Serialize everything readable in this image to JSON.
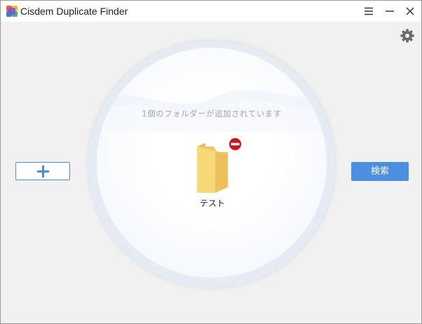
{
  "window": {
    "title": "Cisdem Duplicate Finder"
  },
  "titlebar_icons": {
    "menu": "hamburger-menu-icon",
    "minimize": "minimize-icon",
    "close": "close-icon"
  },
  "toolbar": {
    "settings_icon": "gear-icon"
  },
  "add_button": {
    "icon": "plus-icon"
  },
  "main": {
    "folder_count_text": "1個のフォルダーが追加されています",
    "folders": [
      {
        "name": "テスト",
        "icon": "folder-icon",
        "remove_icon": "remove-badge-icon"
      }
    ]
  },
  "search_button": {
    "label": "検索"
  },
  "colors": {
    "accent": "#4a8fe2",
    "folder": "#f7d46e",
    "remove_badge": "#d0121b",
    "background": "#f1f1f1"
  }
}
